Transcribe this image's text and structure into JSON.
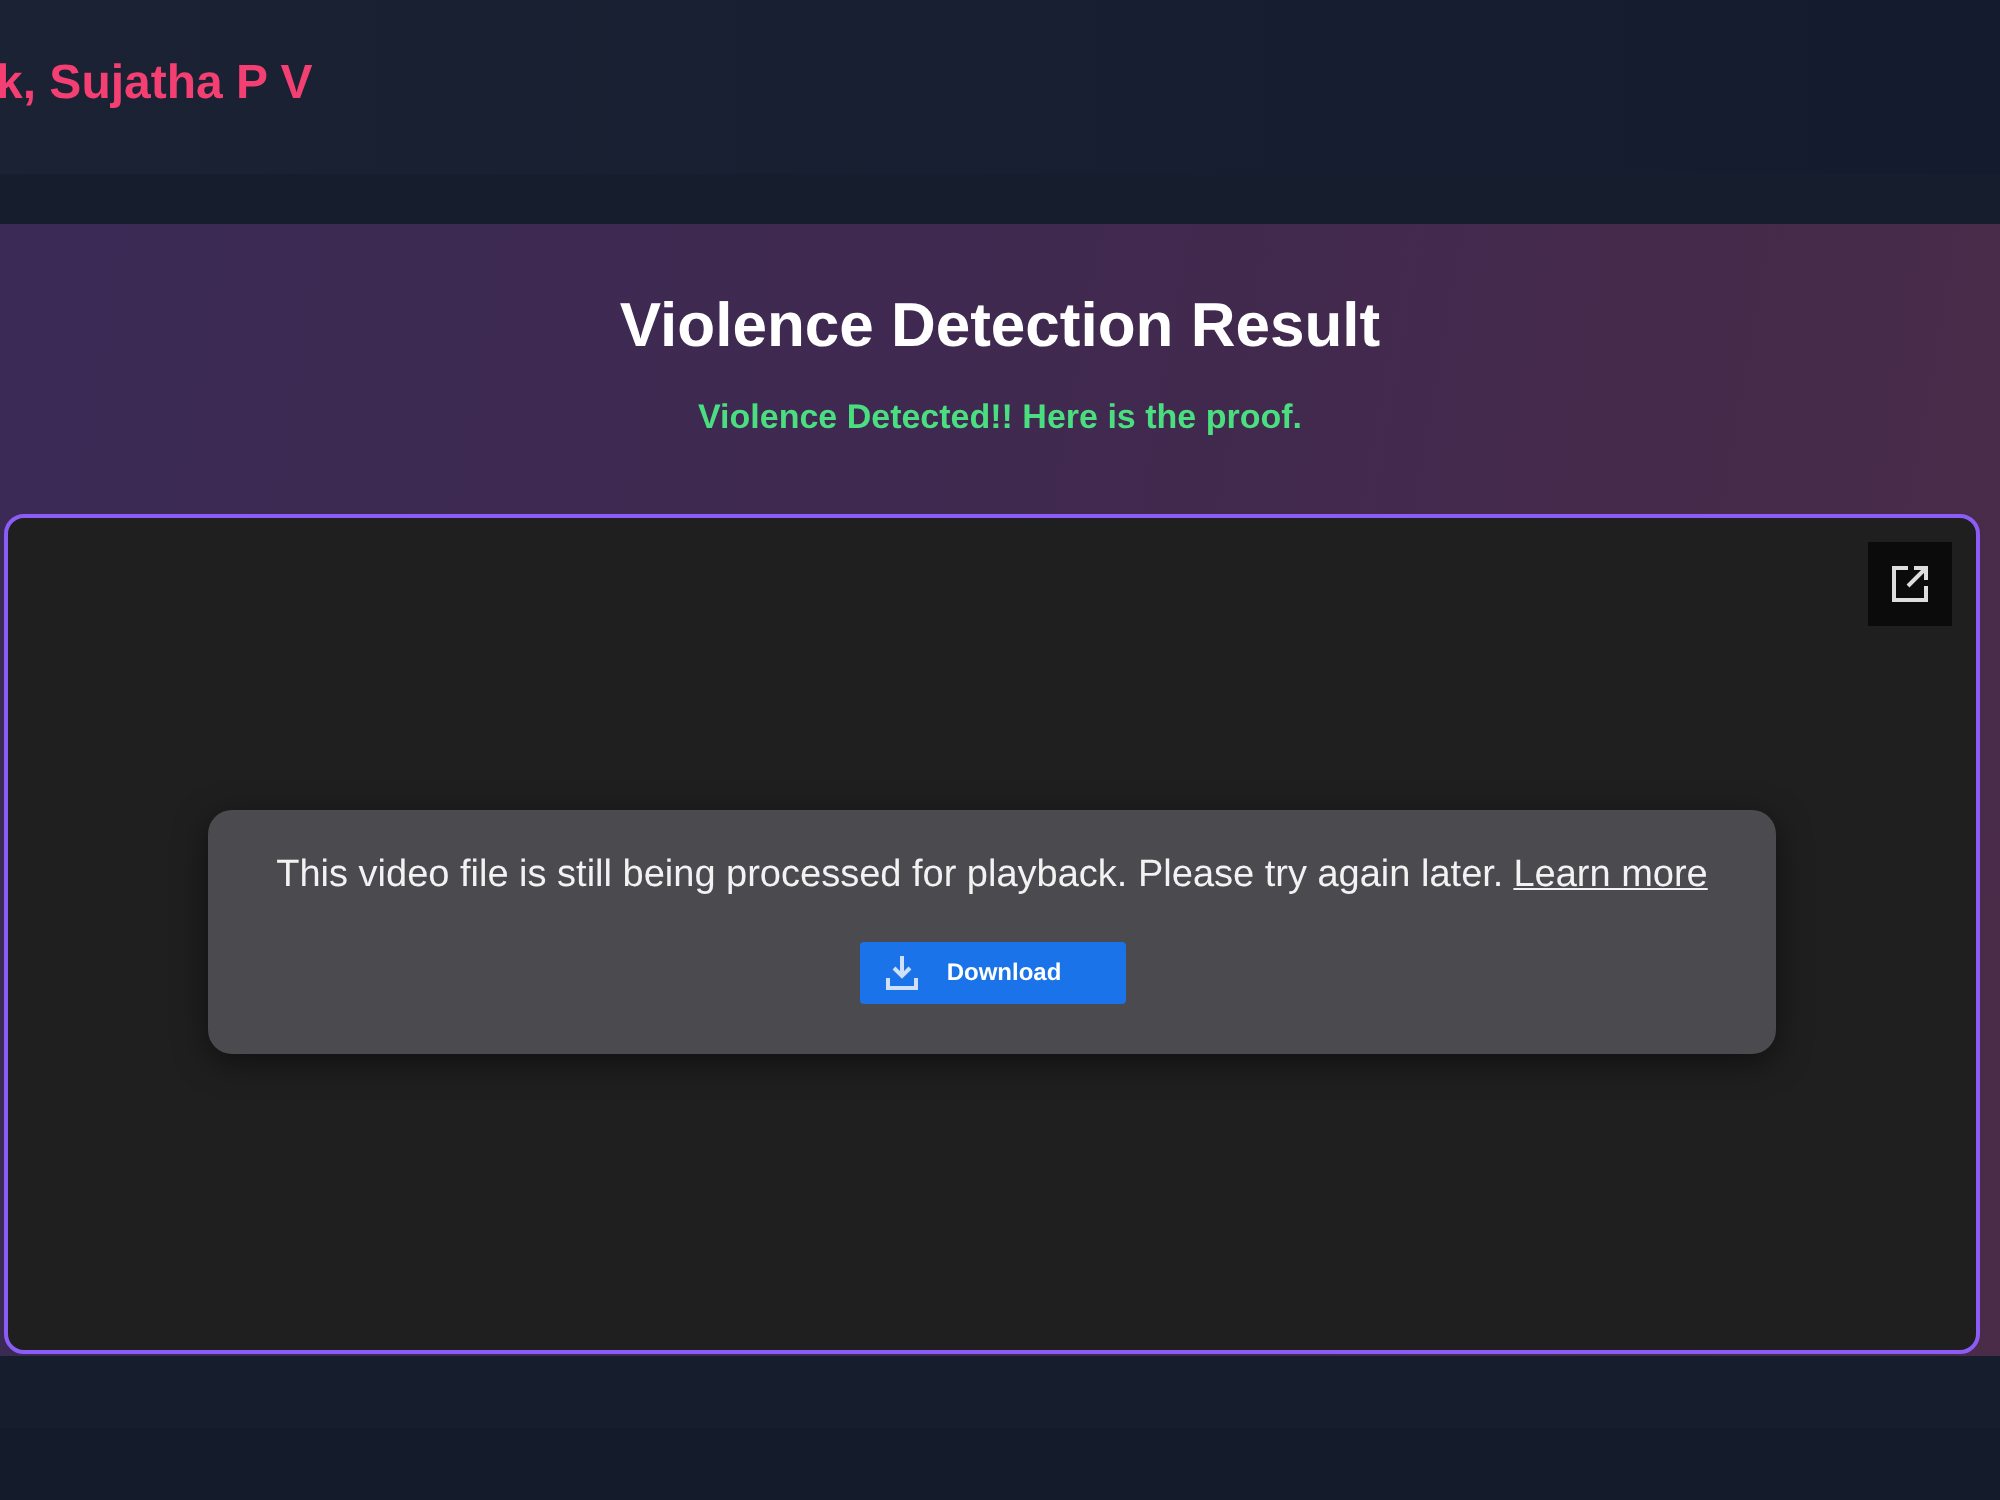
{
  "header": {
    "title": "k, Sujatha P V"
  },
  "result": {
    "title": "Violence Detection Result",
    "message": "Violence Detected!! Here is the proof."
  },
  "player": {
    "notice": "This video file is still being processed for playback. Please try again later.",
    "link": "Learn more",
    "button": "Download"
  }
}
